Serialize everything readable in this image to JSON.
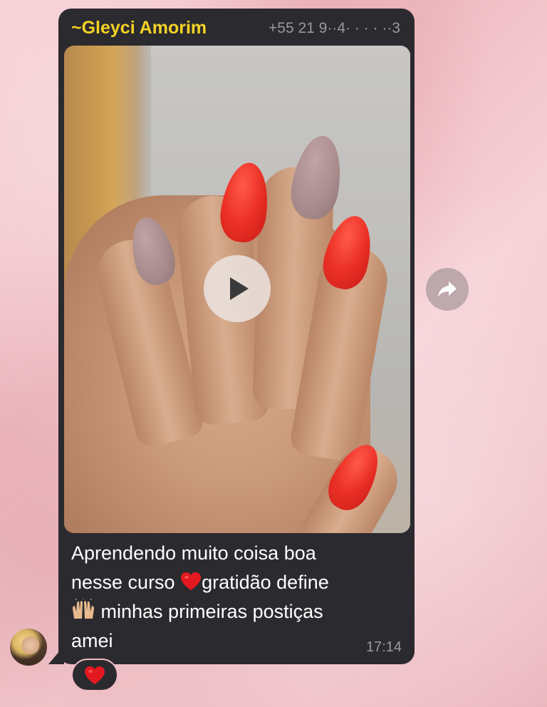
{
  "message": {
    "sender_name": "~Gleyci Amorim",
    "sender_phone": "+55 21 9··4· · · · ··3",
    "caption_lines": [
      "Aprendendo muito coisa boa",
      "nesse curso",
      "gratidão define",
      "minhas primeiras postiças",
      "amei"
    ],
    "time": "17:14",
    "media_type": "video",
    "play_icon": "play-icon"
  },
  "reaction": {
    "emoji_icon": "red-heart-icon"
  },
  "actions": {
    "forward_icon": "forward-arrow-icon"
  },
  "colors": {
    "bubble_bg": "#2b2a2f",
    "sender_name": "#f5d223",
    "meta_text": "#9a999e",
    "caption_text": "#ffffff",
    "wallpaper": "#f0c3c9",
    "heart": "#e3191f"
  }
}
